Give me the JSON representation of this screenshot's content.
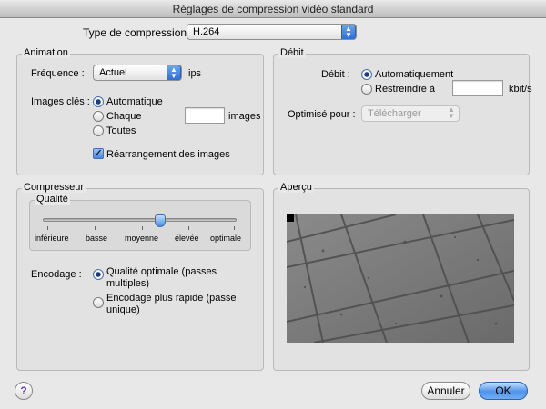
{
  "window": {
    "title": "Réglages de compression vidéo standard"
  },
  "compression": {
    "label": "Type de compression :",
    "value": "H.264"
  },
  "animation": {
    "title": "Animation",
    "frequency_label": "Fréquence :",
    "frequency_value": "Actuel",
    "frequency_unit": "ips",
    "keyframes_label": "Images clés :",
    "keyframes_options": [
      "Automatique",
      "Chaque",
      "Toutes"
    ],
    "keyframes_selected": "Automatique",
    "keyframes_every_value": "",
    "keyframes_unit": "images",
    "reorder_label": "Réarrangement des images",
    "reorder_checked": true
  },
  "debit": {
    "title": "Débit",
    "label": "Débit :",
    "options": [
      "Automatiquement",
      "Restreindre à"
    ],
    "selected": "Automatiquement",
    "limit_value": "",
    "unit": "kbit/s",
    "optimize_label": "Optimisé pour :",
    "optimize_value": "Télécharger"
  },
  "compresseur": {
    "title": "Compresseur",
    "quality_title": "Qualité",
    "quality_levels": [
      "inférieure",
      "basse",
      "moyenne",
      "élevée",
      "optimale"
    ],
    "quality_value": "moyenne",
    "encoding_label": "Encodage :",
    "encoding_options": [
      "Qualité optimale (passes multiples)",
      "Encodage plus rapide (passe unique)"
    ],
    "encoding_selected": "Qualité optimale (passes multiples)"
  },
  "apercu": {
    "title": "Aperçu"
  },
  "buttons": {
    "help": "?",
    "cancel": "Annuler",
    "ok": "OK"
  }
}
